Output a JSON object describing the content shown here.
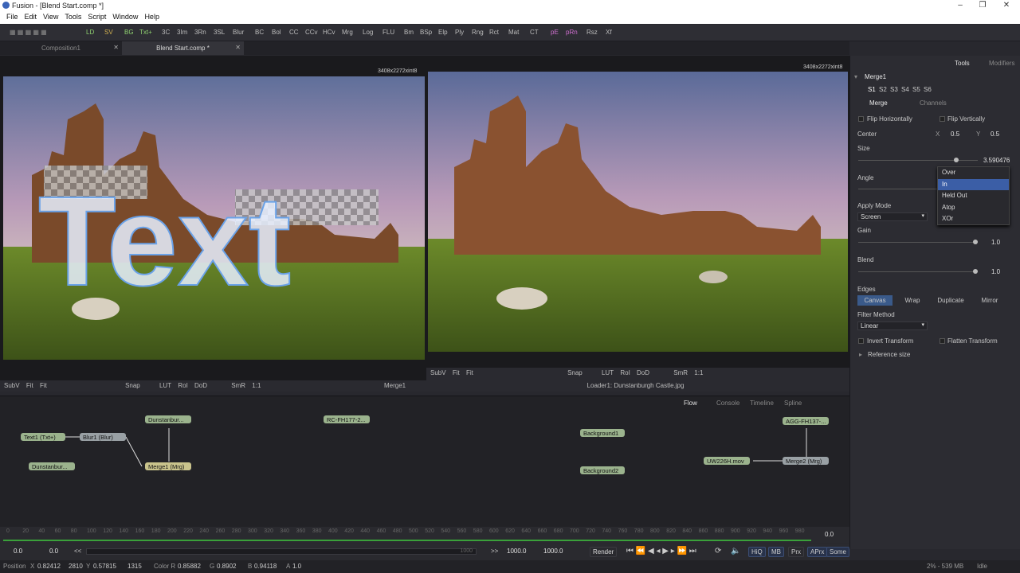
{
  "window": {
    "title": "Fusion - [Blend Start.comp *]"
  },
  "menu": [
    "File",
    "Edit",
    "View",
    "Tools",
    "Script",
    "Window",
    "Help"
  ],
  "toolbar": [
    "LD",
    "SV",
    "BG",
    "Txt+",
    "3C",
    "3Im",
    "3Rn",
    "3SL",
    "Blur",
    "BC",
    "Bol",
    "CC",
    "CCv",
    "HCv",
    "Mrg",
    "Log",
    "FLU",
    "Bm",
    "BSp",
    "Elp",
    "Ply",
    "Rng",
    "Rct",
    "Mat",
    "CT",
    "pE",
    "pRn",
    "Rsz",
    "Xf"
  ],
  "tabs": [
    {
      "label": "Composition1"
    },
    {
      "label": "Blend Start.comp *"
    }
  ],
  "viewers": {
    "left": {
      "resolution": "3408x2272xint8",
      "overlay_text": "Text",
      "bar": [
        "SubV",
        "Fit",
        "Fit",
        "Snap",
        "LUT",
        "RoI",
        "DoD",
        "SmR",
        "1:1"
      ],
      "node": "Merge1"
    },
    "right": {
      "resolution": "3408x2272xint8",
      "bar": [
        "SubV",
        "Fit",
        "Fit",
        "Snap",
        "LUT",
        "RoI",
        "DoD",
        "SmR",
        "1:1"
      ],
      "node": "Loader1: Dunstanburgh Castle.jpg"
    }
  },
  "inspector": {
    "tabs": [
      "Tools",
      "Modifiers"
    ],
    "tool_name": "Merge1",
    "slots": [
      "S1",
      "S2",
      "S3",
      "S4",
      "S5",
      "S6"
    ],
    "subtabs": [
      "Merge",
      "Channels"
    ],
    "flip_h": "Flip Horizontally",
    "flip_v": "Flip Vertically",
    "center_label": "Center",
    "center_x_label": "X",
    "center_x": "0.5",
    "center_y_label": "Y",
    "center_y": "0.5",
    "size_label": "Size",
    "size_value": "3.590476",
    "angle_label": "Angle",
    "apply_mode_label": "Apply Mode",
    "apply_mode": "Screen",
    "gain_label": "Gain",
    "gain_value": "1.0",
    "blend_label": "Blend",
    "blend_value": "1.0",
    "edges_label": "Edges",
    "edges": [
      "Canvas",
      "Wrap",
      "Duplicate",
      "Mirror"
    ],
    "filter_label": "Filter Method",
    "filter": "Linear",
    "invert": "Invert Transform",
    "flatten": "Flatten Transform",
    "reference": "Reference size",
    "operator_menu": [
      "Over",
      "In",
      "Held Out",
      "Atop",
      "XOr"
    ]
  },
  "flow": {
    "tabs": [
      "Flow",
      "Console",
      "Timeline",
      "Spline"
    ],
    "nodes": [
      "Dunstanbur...",
      "Text1 (Txt+)",
      "Blur1 (Blur)",
      "Dunstanbur...",
      "Merge1 (Mrg)",
      "RC-FH177-2...",
      "Background1",
      "Background2",
      "AGG-FH137-...",
      "UW226H.mov",
      "Merge2 (Mrg)"
    ]
  },
  "timeline": {
    "ticks": [
      "0",
      "20",
      "40",
      "60",
      "80",
      "100",
      "120",
      "140",
      "160",
      "180",
      "200",
      "220",
      "240",
      "260",
      "280",
      "300",
      "320",
      "340",
      "360",
      "380",
      "400",
      "420",
      "440",
      "460",
      "480",
      "500",
      "520",
      "540",
      "560",
      "580",
      "600",
      "620",
      "640",
      "660",
      "680",
      "700",
      "720",
      "740",
      "760",
      "780",
      "800",
      "820",
      "840",
      "860",
      "880",
      "900",
      "920",
      "940",
      "960",
      "980"
    ],
    "current": "0.0"
  },
  "transport": {
    "start": "0.0",
    "render_start": "0.0",
    "render_end": "1000.0",
    "end": "1000.0",
    "range_end": "1000",
    "render": "Render",
    "buttons": [
      "HiQ",
      "MB",
      "Prx",
      "APrx",
      "Some"
    ]
  },
  "status": {
    "position_label": "Position",
    "x_label": "X",
    "x": "0.82412",
    "px": "2810",
    "y_label": "Y",
    "y": "0.57815",
    "py": "1315",
    "r_label": "Color R",
    "r": "0.85882",
    "g_label": "G",
    "g": "0.8902",
    "b_label": "B",
    "b": "0.94118",
    "a_label": "A",
    "a": "1.0",
    "memory": "2% - 539 MB",
    "state": "Idle"
  }
}
